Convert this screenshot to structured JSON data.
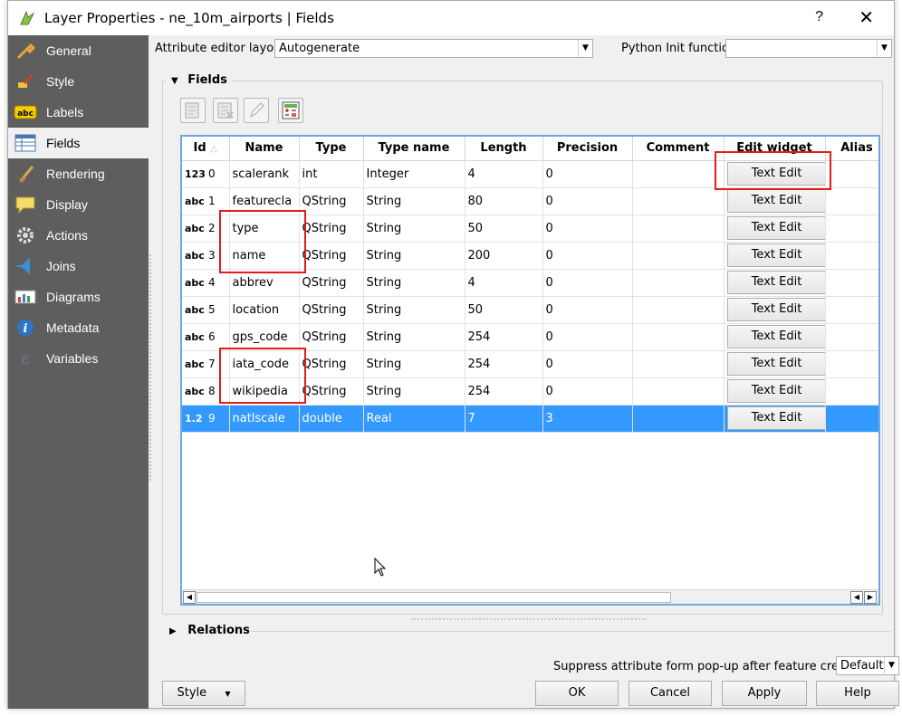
{
  "window": {
    "title": "Layer Properties - ne_10m_airports | Fields",
    "help": "?",
    "close": "✕"
  },
  "sidebar": {
    "items": [
      {
        "label": "General",
        "icon": "wrench-icon"
      },
      {
        "label": "Style",
        "icon": "paintbrush-icon"
      },
      {
        "label": "Labels",
        "icon": "abc-label-icon"
      },
      {
        "label": "Fields",
        "icon": "table-icon"
      },
      {
        "label": "Rendering",
        "icon": "brush-icon"
      },
      {
        "label": "Display",
        "icon": "speech-bubble-icon"
      },
      {
        "label": "Actions",
        "icon": "gear-icon"
      },
      {
        "label": "Joins",
        "icon": "join-icon"
      },
      {
        "label": "Diagrams",
        "icon": "chart-icon"
      },
      {
        "label": "Metadata",
        "icon": "info-icon"
      },
      {
        "label": "Variables",
        "icon": "epsilon-icon"
      }
    ],
    "active": "Fields"
  },
  "top": {
    "editor_layout_label": "Attribute editor layout:",
    "editor_layout_value": "Autogenerate",
    "python_init_label": "Python Init function",
    "python_init_value": ""
  },
  "fields_section": {
    "title": "Fields",
    "columns": [
      "Id",
      "Name",
      "Type",
      "Type name",
      "Length",
      "Precision",
      "Comment",
      "Edit widget",
      "Alias"
    ],
    "rows": [
      {
        "tag": "123",
        "id": "0",
        "name": "scalerank",
        "type": "int",
        "type_name": "Integer",
        "length": "4",
        "precision": "0",
        "comment": "",
        "widget": "Text Edit"
      },
      {
        "tag": "abc",
        "id": "1",
        "name": "featurecla",
        "type": "QString",
        "type_name": "String",
        "length": "80",
        "precision": "0",
        "comment": "",
        "widget": "Text Edit"
      },
      {
        "tag": "abc",
        "id": "2",
        "name": "type",
        "type": "QString",
        "type_name": "String",
        "length": "50",
        "precision": "0",
        "comment": "",
        "widget": "Text Edit"
      },
      {
        "tag": "abc",
        "id": "3",
        "name": "name",
        "type": "QString",
        "type_name": "String",
        "length": "200",
        "precision": "0",
        "comment": "",
        "widget": "Text Edit"
      },
      {
        "tag": "abc",
        "id": "4",
        "name": "abbrev",
        "type": "QString",
        "type_name": "String",
        "length": "4",
        "precision": "0",
        "comment": "",
        "widget": "Text Edit"
      },
      {
        "tag": "abc",
        "id": "5",
        "name": "location",
        "type": "QString",
        "type_name": "String",
        "length": "50",
        "precision": "0",
        "comment": "",
        "widget": "Text Edit"
      },
      {
        "tag": "abc",
        "id": "6",
        "name": "gps_code",
        "type": "QString",
        "type_name": "String",
        "length": "254",
        "precision": "0",
        "comment": "",
        "widget": "Text Edit"
      },
      {
        "tag": "abc",
        "id": "7",
        "name": "iata_code",
        "type": "QString",
        "type_name": "String",
        "length": "254",
        "precision": "0",
        "comment": "",
        "widget": "Text Edit"
      },
      {
        "tag": "abc",
        "id": "8",
        "name": "wikipedia",
        "type": "QString",
        "type_name": "String",
        "length": "254",
        "precision": "0",
        "comment": "",
        "widget": "Text Edit"
      },
      {
        "tag": "1.2",
        "id": "9",
        "name": "natlscale",
        "type": "double",
        "type_name": "Real",
        "length": "7",
        "precision": "3",
        "comment": "",
        "widget": "Text Edit"
      }
    ],
    "selected_row": 9
  },
  "relations_section": {
    "title": "Relations"
  },
  "bottom": {
    "suppress_label": "Suppress attribute form pop-up after feature creation",
    "suppress_value": "Default",
    "style_button": "Style",
    "ok": "OK",
    "cancel": "Cancel",
    "apply": "Apply",
    "help": "Help"
  },
  "colors": {
    "sidebar_bg": "#5e5e5e",
    "selection": "#3399ff",
    "annotation": "#e31b1b"
  }
}
